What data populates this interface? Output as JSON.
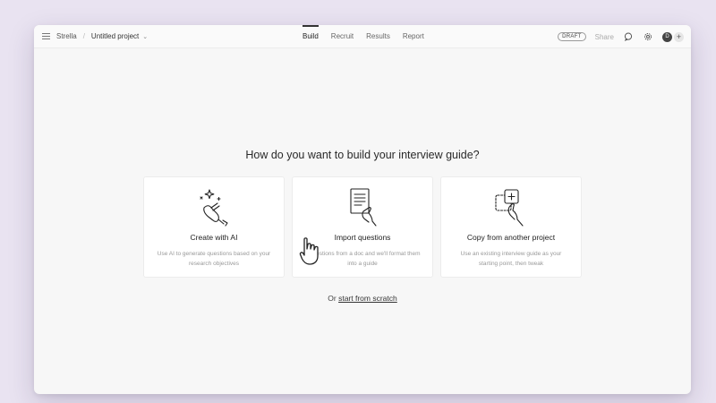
{
  "header": {
    "brand": "Strella",
    "separator": "/",
    "project_name": "Untitled project",
    "tabs": [
      {
        "label": "Build",
        "active": true
      },
      {
        "label": "Recruit",
        "active": false
      },
      {
        "label": "Results",
        "active": false
      },
      {
        "label": "Report",
        "active": false
      }
    ],
    "status_badge": "DRAFT",
    "share_label": "Share",
    "avatar_initial": "D",
    "add_label": "+"
  },
  "main": {
    "question": "How do you want to build your interview guide?",
    "cards": [
      {
        "title": "Create with AI",
        "description": "Use AI to generate questions based on your research objectives",
        "icon": "sparkle-hand-icon"
      },
      {
        "title": "Import questions",
        "description": "e questions from a doc and we'll format them into a guide",
        "icon": "document-hand-icon"
      },
      {
        "title": "Copy from another project",
        "description": "Use an existing interview guide as your starting point, then tweak",
        "icon": "copy-hand-icon"
      }
    ],
    "footer_prefix": "Or",
    "footer_link": "start from scratch"
  },
  "colors": {
    "background": "#e9e3f1",
    "window": "#f7f7f7",
    "card": "#ffffff",
    "text": "#222222",
    "muted": "#999999"
  }
}
